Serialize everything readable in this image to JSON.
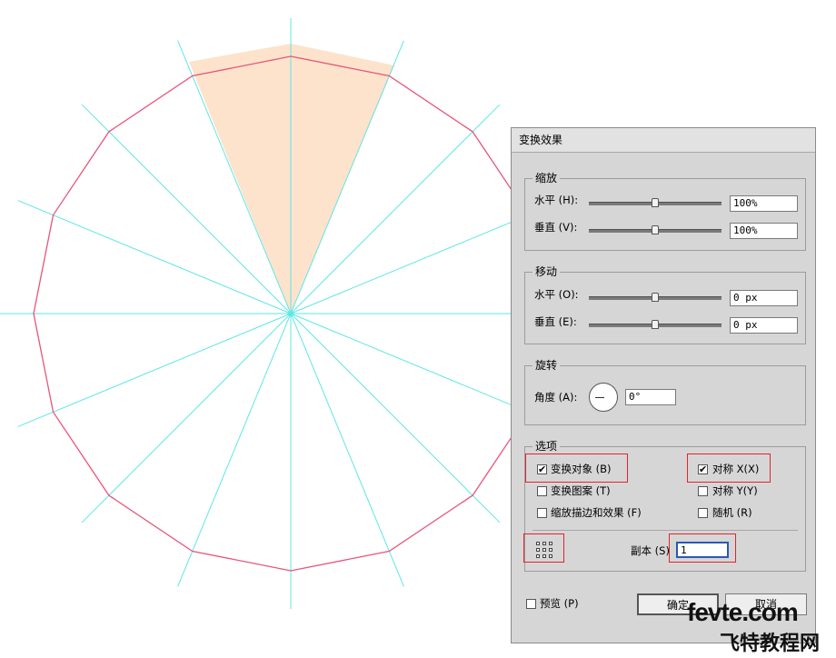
{
  "canvas": {
    "colors": {
      "polygon": "#e8547a",
      "guides": "#5fe6e6",
      "wedge": "#fde1c9"
    }
  },
  "dialog": {
    "title": "变换效果",
    "scale": {
      "legend": "缩放",
      "horizontal_label": "水平 (H):",
      "horizontal_value": "100%",
      "vertical_label": "垂直 (V):",
      "vertical_value": "100%"
    },
    "move": {
      "legend": "移动",
      "horizontal_label": "水平 (O):",
      "horizontal_value": "0 px",
      "vertical_label": "垂直 (E):",
      "vertical_value": "0 px"
    },
    "rotate": {
      "legend": "旋转",
      "angle_label": "角度 (A):",
      "angle_value": "0°"
    },
    "options": {
      "legend": "选项",
      "transform_objects": {
        "label": "变换对象 (B)",
        "checked": true
      },
      "reflect_x": {
        "label": "对称 X(X)",
        "checked": true
      },
      "transform_patterns": {
        "label": "变换图案 (T)",
        "checked": false
      },
      "reflect_y": {
        "label": "对称 Y(Y)",
        "checked": false
      },
      "scale_strokes": {
        "label": "缩放描边和效果 (F)",
        "checked": false
      },
      "random": {
        "label": "随机 (R)",
        "checked": false
      },
      "copies_label": "副本 (S)",
      "copies_value": "1"
    },
    "preview": {
      "label": "预览 (P)",
      "checked": false
    },
    "ok_label": "确定",
    "cancel_label": "取消"
  },
  "watermark": {
    "line1": "fevte.com",
    "line2": "飞特教程网"
  }
}
